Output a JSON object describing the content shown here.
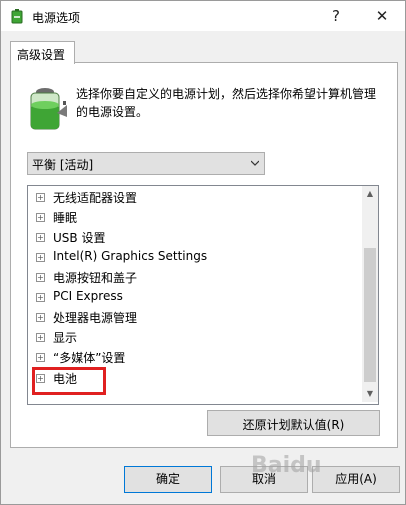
{
  "window": {
    "title": "电源选项",
    "help_glyph": "?",
    "close_glyph": "✕"
  },
  "tab": {
    "label": "高级设置"
  },
  "description": "选择你要自定义的电源计划，然后选择你希望计算机管理的电源设置。",
  "plan_select": {
    "value": "平衡 [活动]"
  },
  "tree": {
    "items": [
      {
        "label": "无线适配器设置"
      },
      {
        "label": "睡眠"
      },
      {
        "label": "USB 设置"
      },
      {
        "label": "Intel(R) Graphics Settings"
      },
      {
        "label": "电源按钮和盖子"
      },
      {
        "label": "PCI Express"
      },
      {
        "label": "处理器电源管理"
      },
      {
        "label": "显示"
      },
      {
        "label": "“多媒体”设置"
      },
      {
        "label": "电池"
      }
    ],
    "expander_glyph": "+"
  },
  "buttons": {
    "restore": "还原计划默认值(R)",
    "ok": "确定",
    "cancel": "取消",
    "apply": "应用(A)"
  },
  "colors": {
    "highlight_box": "#e02020",
    "accent": "#0078d7",
    "battery_green": "#3fa535"
  },
  "watermark": "Baidu"
}
